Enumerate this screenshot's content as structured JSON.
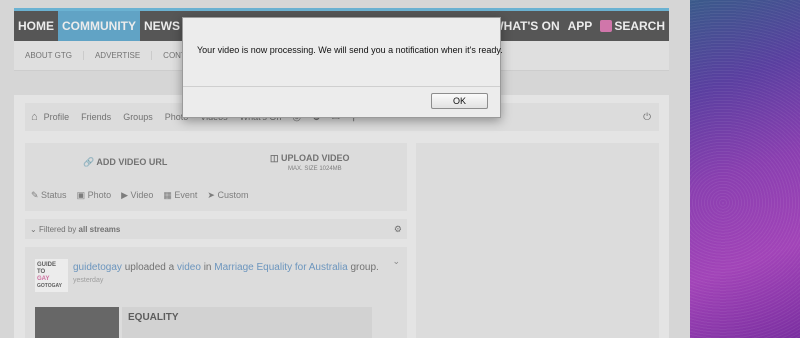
{
  "topnav": {
    "items": [
      "HOME",
      "COMMUNITY",
      "NEWS",
      "WHAT'S ON",
      "APP",
      "SEARCH"
    ],
    "active": "COMMUNITY"
  },
  "subnav": {
    "items": [
      "ABOUT GTG",
      "ADVERTISE",
      "CONTRIB"
    ]
  },
  "toolbar": {
    "items": [
      "Profile",
      "Friends",
      "Groups",
      "Photo",
      "Videos",
      "What's On"
    ]
  },
  "composer": {
    "add_video_url": "ADD VIDEO URL",
    "upload_video": "UPLOAD VIDEO",
    "max_size": "MAX. SIZE 1024MB",
    "types": [
      "Status",
      "Photo",
      "Video",
      "Event",
      "Custom"
    ]
  },
  "filter": {
    "prefix": "Filtered by",
    "value": "all streams"
  },
  "post": {
    "avatar_lines": [
      "GUIDE",
      "TO",
      "GAY",
      "GOTOGAY"
    ],
    "author": "guidetogay",
    "action": "uploaded a",
    "object": "video",
    "in_text": "in",
    "group": "Marriage Equality for Australia",
    "suffix": "group.",
    "time": "yesterday",
    "card_title": "EQUALITY"
  },
  "dialog": {
    "message": "Your video is now processing. We will send you a notification when it's ready.",
    "ok_label": "OK"
  },
  "colors": {
    "nav_bg": "#1a1a1a",
    "nav_accent": "#2a8fc4",
    "nav_top_border": "#3aa7d8",
    "pink": "#d44a9a",
    "link": "#3a7ab8"
  }
}
